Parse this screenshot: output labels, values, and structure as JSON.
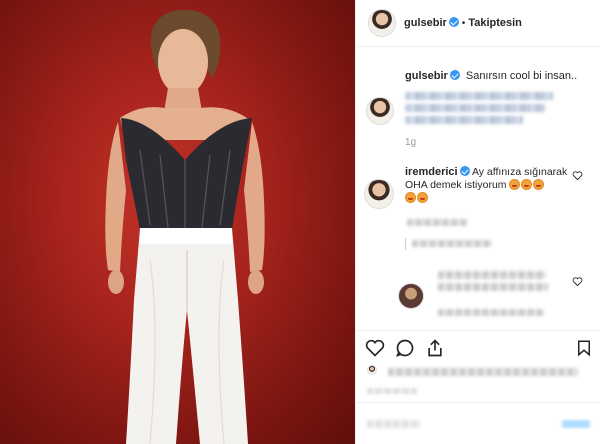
{
  "header": {
    "username": "gulsebir",
    "follow_status": "Takiptesin",
    "separator": "•"
  },
  "caption": {
    "username": "gulsebir",
    "text": "Sanırsın cool bi insan.."
  },
  "first_comment": {
    "time": "1g"
  },
  "comment_irem": {
    "username": "iremderici",
    "text_line1": "Ay affınıza sığınarak",
    "text_line2": "OHA demek istiyorum"
  },
  "reply": {
    "text": "öyle de ama"
  },
  "colors": {
    "verified": "#3897f0",
    "post_button": "#b3dbff",
    "photo_bg": "#a8241d"
  },
  "icons": [
    "heart-icon",
    "comment-icon",
    "share-icon",
    "bookmark-icon"
  ]
}
